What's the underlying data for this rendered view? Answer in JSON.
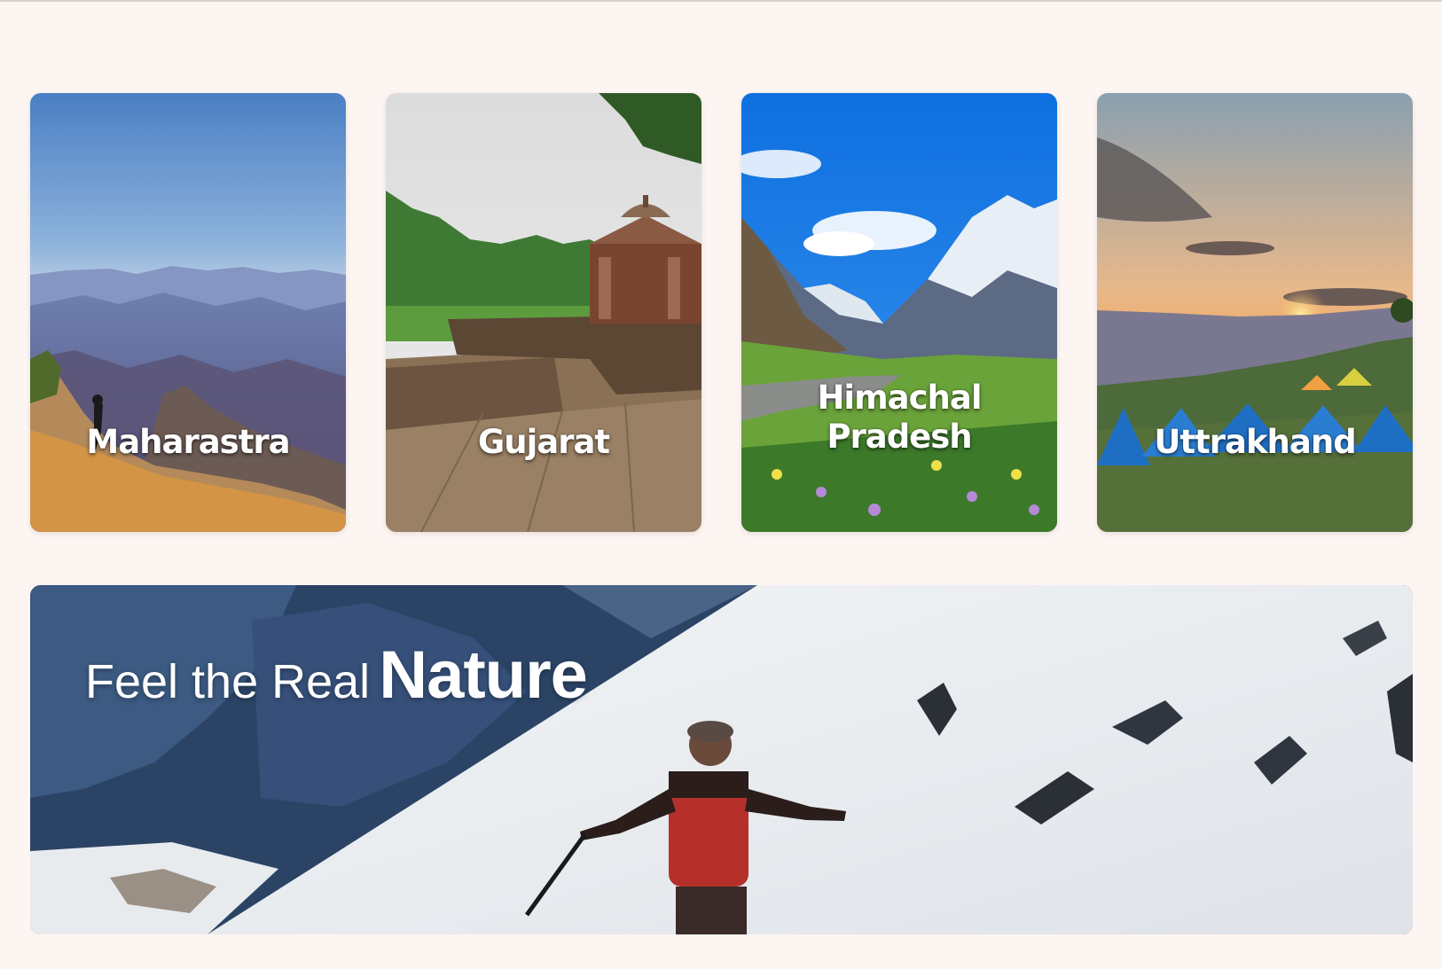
{
  "destinations": [
    {
      "label": "Maharastra"
    },
    {
      "label": "Gujarat"
    },
    {
      "label": "Himachal\nPradesh"
    },
    {
      "label": "Uttrakhand"
    }
  ],
  "banner": {
    "headline_light": "Feel the Real",
    "headline_bold": "Nature"
  },
  "colors": {
    "page_background": "#fdf5f2",
    "label_text": "#ffffff"
  }
}
